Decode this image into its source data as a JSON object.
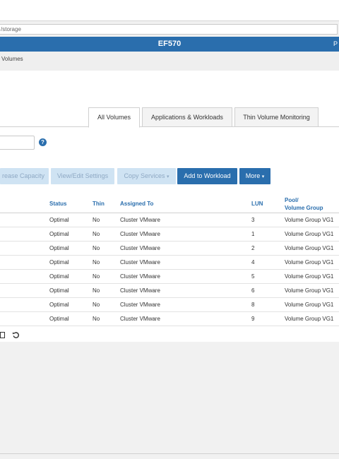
{
  "browser": {
    "url": "/storage"
  },
  "header": {
    "title": "EF570",
    "right_text": "P"
  },
  "breadcrumb": "Volumes",
  "tabs": [
    {
      "label": "All Volumes",
      "active": true
    },
    {
      "label": "Applications & Workloads",
      "active": false
    },
    {
      "label": "Thin Volume Monitoring",
      "active": false
    }
  ],
  "search": {
    "value": "",
    "help_icon": "?"
  },
  "toolbar": {
    "increase_capacity": "rease Capacity",
    "view_edit_settings": "View/Edit Settings",
    "copy_services": "Copy Services",
    "add_to_workload": "Add to Workload",
    "more": "More",
    "caret": "▾"
  },
  "table": {
    "headers": {
      "status": "Status",
      "thin": "Thin",
      "assigned_to": "Assigned To",
      "lun": "LUN",
      "pool_line1": "Pool/",
      "pool_line2": "Volume Group"
    },
    "rows": [
      {
        "status": "Optimal",
        "thin": "No",
        "assigned_to": "Cluster VMware",
        "lun": "3",
        "pool": "Volume Group VG1"
      },
      {
        "status": "Optimal",
        "thin": "No",
        "assigned_to": "Cluster VMware",
        "lun": "1",
        "pool": "Volume Group VG1"
      },
      {
        "status": "Optimal",
        "thin": "No",
        "assigned_to": "Cluster VMware",
        "lun": "2",
        "pool": "Volume Group VG1"
      },
      {
        "status": "Optimal",
        "thin": "No",
        "assigned_to": "Cluster VMware",
        "lun": "4",
        "pool": "Volume Group VG1"
      },
      {
        "status": "Optimal",
        "thin": "No",
        "assigned_to": "Cluster VMware",
        "lun": "5",
        "pool": "Volume Group VG1"
      },
      {
        "status": "Optimal",
        "thin": "No",
        "assigned_to": "Cluster VMware",
        "lun": "6",
        "pool": "Volume Group VG1"
      },
      {
        "status": "Optimal",
        "thin": "No",
        "assigned_to": "Cluster VMware",
        "lun": "8",
        "pool": "Volume Group VG1"
      },
      {
        "status": "Optimal",
        "thin": "No",
        "assigned_to": "Cluster VMware",
        "lun": "9",
        "pool": "Volume Group VG1"
      }
    ]
  },
  "footer": {
    "icons": [
      "column-settings-icon",
      "refresh-icon"
    ]
  },
  "colors": {
    "brand": "#2a6ead",
    "disabled_button": "#cfe3f3"
  }
}
